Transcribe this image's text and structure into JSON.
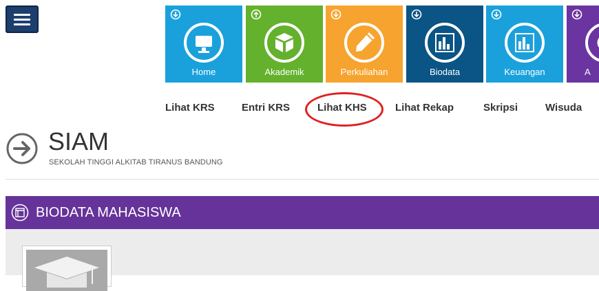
{
  "tiles": [
    {
      "label": "Home",
      "color": "#1aa1dc",
      "icon": "monitor-icon"
    },
    {
      "label": "Akademik",
      "color": "#63b12c",
      "icon": "box-icon"
    },
    {
      "label": "Perkuliahan",
      "color": "#f6a42f",
      "icon": "pen-icon"
    },
    {
      "label": "Biodata",
      "color": "#0a5486",
      "icon": "bar-chart-icon"
    },
    {
      "label": "Keuangan",
      "color": "#1aa1dc",
      "icon": "bar-chart-icon"
    },
    {
      "label": "A",
      "color": "#6a35a0",
      "icon": "gear-icon"
    }
  ],
  "subnav": [
    "Lihat KRS",
    "Entri KRS",
    "Lihat KHS",
    "Lihat Rekap",
    "Skripsi",
    "Wisuda"
  ],
  "header": {
    "title": "SIAM",
    "subtitle": "SEKOLAH TINGGI ALKITAB TIRANUS BANDUNG"
  },
  "panel": {
    "title": "BIODATA MAHASISWA",
    "color": "#653399"
  },
  "highlight": {
    "color": "#e02020"
  }
}
